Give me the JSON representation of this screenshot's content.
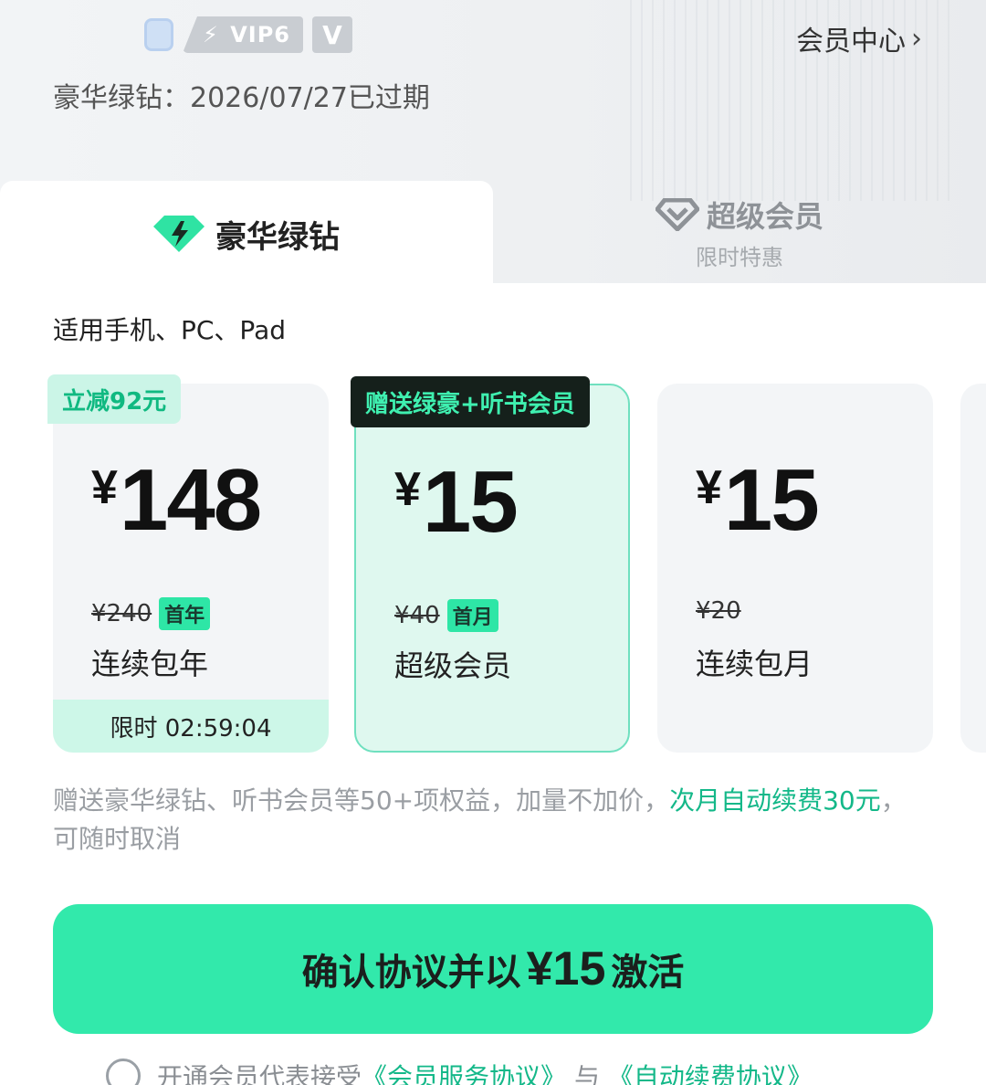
{
  "header": {
    "vip_label": "VIP6",
    "v_badge": "V",
    "member_center": "会员中心",
    "member_center_icon": "chevron-right-icon",
    "expire_text": "豪华绿钻：2026/07/27已过期"
  },
  "tabs": [
    {
      "label": "豪华绿钻",
      "icon": "green-diamond-icon",
      "active": true
    },
    {
      "label": "超级会员",
      "sub": "限时特惠",
      "icon": "diamond-outline-icon",
      "active": false
    }
  ],
  "applies_to": "适用手机、PC、Pad",
  "plans": [
    {
      "tag": "立减92元",
      "currency": "¥",
      "price": "148",
      "original_price": "¥240",
      "period_tag": "首年",
      "name": "连续包年",
      "timer": "限时 02:59:04",
      "selected": false
    },
    {
      "tag": "赠送绿豪+听书会员",
      "currency": "¥",
      "price": "15",
      "original_price": "¥40",
      "period_tag": "首月",
      "name": "超级会员",
      "selected": true
    },
    {
      "currency": "¥",
      "price": "15",
      "original_price": "¥20",
      "name": "连续包月",
      "selected": false
    }
  ],
  "description": {
    "main": "赠送豪华绿钻、听书会员等50+项权益，加量不加价，",
    "accent": "次月自动续费30元",
    "tail": "，可随时取消"
  },
  "cta": {
    "prefix": "确认协议并以",
    "amount": "¥15",
    "suffix": "激活"
  },
  "agreement": {
    "text": "开通会员代表接受",
    "link1": "《会员服务协议》",
    "joiner": "与",
    "link2": "《自动续费协议》"
  },
  "colors": {
    "accent": "#32e9ab",
    "accent_text": "#14b889",
    "selected_card_bg": "#dff8ef",
    "tag_dark_bg": "#15201b"
  }
}
